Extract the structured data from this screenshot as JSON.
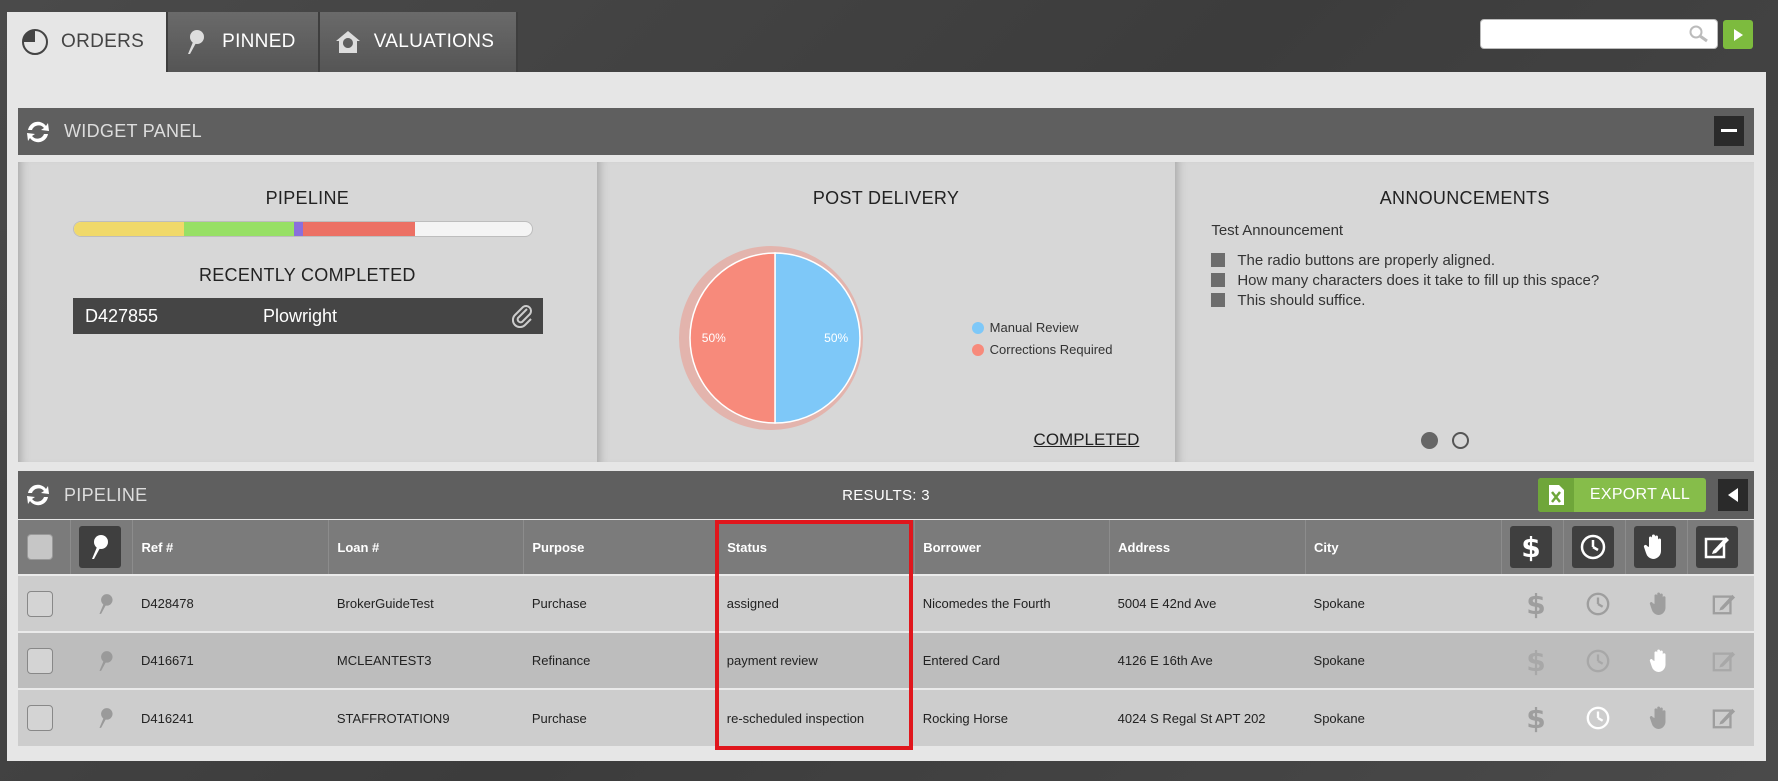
{
  "tabs": [
    {
      "label": "ORDERS",
      "icon": "pie-chart-icon"
    },
    {
      "label": "PINNED",
      "icon": "pin-icon"
    },
    {
      "label": "VALUATIONS",
      "icon": "house-icon"
    }
  ],
  "search": {
    "placeholder": "",
    "value": ""
  },
  "widget_panel": {
    "title": "WIDGET PANEL",
    "pipeline": {
      "title": "PIPELINE",
      "segments": [
        {
          "color": "#f0d96a",
          "fraction": 0.24
        },
        {
          "color": "#97e065",
          "fraction": 0.24
        },
        {
          "color": "#8a6fdc",
          "fraction": 0.02
        },
        {
          "color": "#ec7064",
          "fraction": 0.245
        }
      ],
      "recently_completed_title": "RECENTLY COMPLETED",
      "recent": {
        "ref": "D427855",
        "name": "Plowright"
      }
    },
    "post_delivery": {
      "title": "POST DELIVERY",
      "completed_link": "COMPLETED"
    },
    "announcements": {
      "title": "ANNOUNCEMENTS",
      "subtitle": "Test Announcement",
      "items": [
        "The radio buttons are properly aligned.",
        "How many characters does it take to fill up this space?",
        "This should suffice."
      ]
    }
  },
  "chart_data": {
    "type": "pie",
    "title": "POST DELIVERY",
    "labels": [
      "Manual Review",
      "Corrections Required"
    ],
    "values": [
      50,
      50
    ],
    "data_labels": [
      "50%",
      "50%"
    ],
    "colors": [
      "#7ec8f8",
      "#f78a7b"
    ],
    "legend_position": "right"
  },
  "pipeline": {
    "title": "PIPELINE",
    "results": "RESULTS: 3",
    "export_label": "EXPORT ALL",
    "columns": [
      "Ref #",
      "Loan #",
      "Purpose",
      "Status",
      "Borrower",
      "Address",
      "City"
    ],
    "rows": [
      {
        "ref": "D428478",
        "loan": "BrokerGuideTest",
        "purpose": "Purchase",
        "status": "assigned",
        "borrower": "Nicomedes the Fourth",
        "address": "5004 E 42nd Ave",
        "city": "Spokane"
      },
      {
        "ref": "D416671",
        "loan": "MCLEANTEST3",
        "purpose": "Refinance",
        "status": "payment review",
        "borrower": "Entered Card",
        "address": "4126 E 16th Ave",
        "city": "Spokane"
      },
      {
        "ref": "D416241",
        "loan": "STAFFROTATION9",
        "purpose": "Purchase",
        "status": "re-scheduled inspection",
        "borrower": "Rocking Horse",
        "address": "4024 S Regal St APT 202",
        "city": "Spokane"
      }
    ]
  }
}
